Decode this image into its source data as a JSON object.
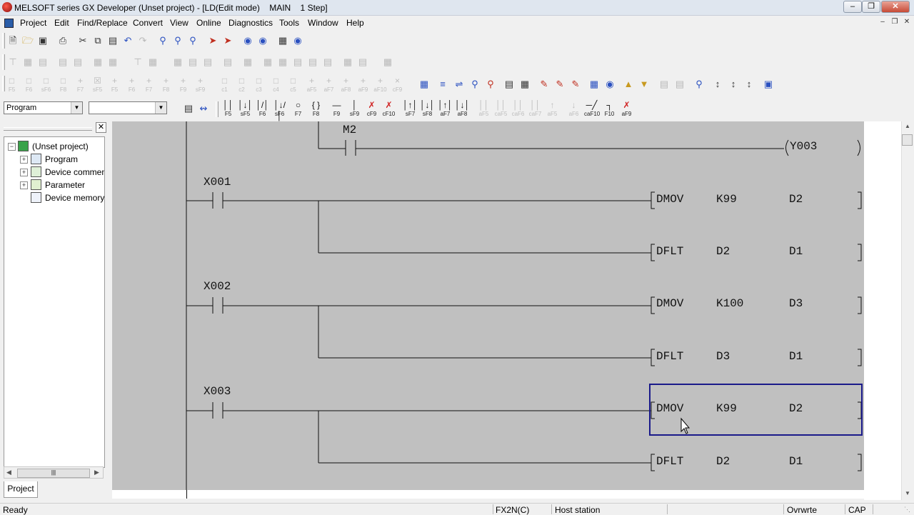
{
  "window": {
    "title": "MELSOFT series GX Developer (Unset project) - [LD(Edit mode)    MAIN    1 Step]",
    "controls": [
      "–",
      "❐",
      "✕"
    ]
  },
  "menu": [
    "Project",
    "Edit",
    "Find/Replace",
    "Convert",
    "View",
    "Online",
    "Diagnostics",
    "Tools",
    "Window",
    "Help"
  ],
  "mdi_controls": [
    "–",
    "❐",
    "✕"
  ],
  "toolbar_combo": {
    "data_type": "Program",
    "second": ""
  },
  "function_keys": [
    {
      "sym": "││",
      "key": "F5"
    },
    {
      "sym": "│↓│",
      "key": "sF5"
    },
    {
      "sym": "│/│",
      "key": "F6"
    },
    {
      "sym": "│↓/│",
      "key": "sF6"
    },
    {
      "sym": "○",
      "key": "F7"
    },
    {
      "sym": "{ }",
      "key": "F8"
    },
    {
      "sym": "—",
      "key": "F9"
    },
    {
      "sym": "│",
      "key": "sF9"
    },
    {
      "sym": "✗",
      "key": "cF9"
    },
    {
      "sym": "✗",
      "key": "cF10"
    },
    {
      "sym": "│↑│",
      "key": "sF7"
    },
    {
      "sym": "│↓│",
      "key": "sF8"
    },
    {
      "sym": "│↑│",
      "key": "aF7"
    },
    {
      "sym": "│↓│",
      "key": "aF8"
    }
  ],
  "function_keys_right": [
    {
      "sym": "─╱",
      "key": "caF10"
    },
    {
      "sym": "┐",
      "key": "F10"
    },
    {
      "sym": "✗",
      "key": "aF9"
    }
  ],
  "project_tree": {
    "root": "(Unset project)",
    "items": [
      "Program",
      "Device commen",
      "Parameter",
      "Device memory"
    ],
    "tab": "Project"
  },
  "ladder": {
    "rungs": [
      {
        "contact": "M2",
        "coil": "Y003"
      },
      {
        "contact": "X001",
        "instr": [
          [
            "DMOV",
            "K99",
            "D2"
          ],
          [
            "DFLT",
            "D2",
            "D1"
          ]
        ]
      },
      {
        "contact": "X002",
        "instr": [
          [
            "DMOV",
            "K100",
            "D3"
          ],
          [
            "DFLT",
            "D3",
            "D1"
          ]
        ]
      },
      {
        "contact": "X003",
        "instr": [
          [
            "DMOV",
            "K99",
            "D2"
          ],
          [
            "DFLT",
            "D2",
            "D1"
          ]
        ]
      }
    ]
  },
  "status": {
    "ready": "Ready",
    "cpu": "FX2N(C)",
    "station": "Host station",
    "mode": "Ovrwrte",
    "caps": "CAP"
  },
  "colors": {
    "ladder_bg": "#c0c0c0",
    "cursor_box": "#1a1a8a"
  }
}
